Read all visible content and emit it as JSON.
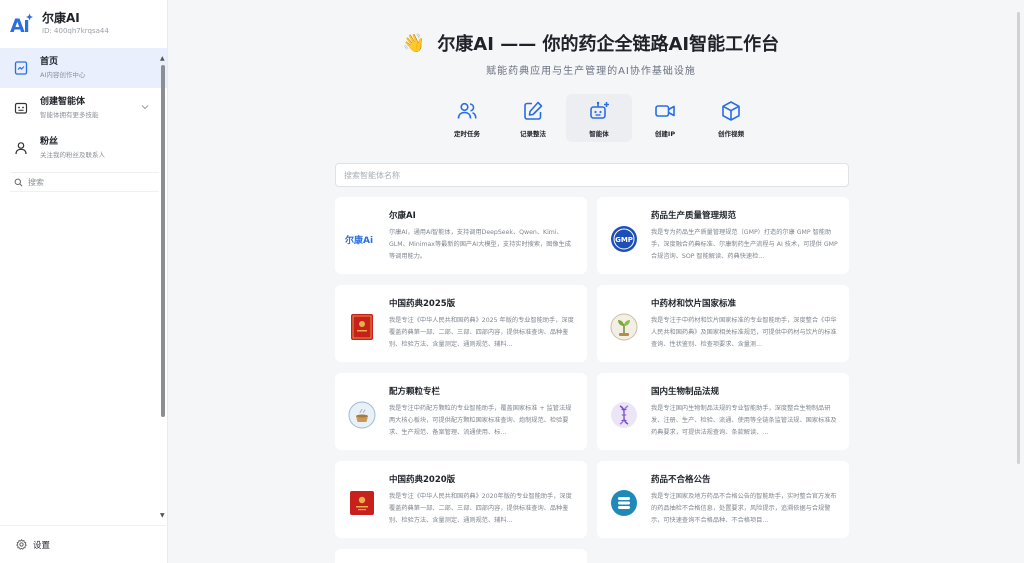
{
  "brand": {
    "name": "尔康AI",
    "id": "ID: 400qh7krqsa44"
  },
  "sidebar": {
    "items": [
      {
        "label": "首页",
        "sub": "AI内容创作中心",
        "icon": "home-doc-icon",
        "active": true
      },
      {
        "label": "创建智能体",
        "sub": "智能体拥有更多技能",
        "icon": "robot-icon",
        "active": false
      },
      {
        "label": "粉丝",
        "sub": "关注我的粉丝及联系人",
        "icon": "user-icon",
        "active": false
      }
    ],
    "search_label": "搜索",
    "settings_label": "设置"
  },
  "hero": {
    "emoji": "👋",
    "title": "尔康AI —— 你的药企全链路AI智能工作台",
    "subtitle": "赋能药典应用与生产管理的AI协作基础设施"
  },
  "tools": [
    {
      "label": "定时任务",
      "icon": "users-icon",
      "active": false
    },
    {
      "label": "记录整法",
      "icon": "edit-icon",
      "active": false
    },
    {
      "label": "智能体",
      "icon": "bot-icon",
      "active": true
    },
    {
      "label": "创建IP",
      "icon": "video-icon",
      "active": false
    },
    {
      "label": "创作视频",
      "icon": "box-icon",
      "active": false
    }
  ],
  "search": {
    "placeholder": "搜索智能体名称"
  },
  "cards": [
    {
      "title": "尔康AI",
      "desc": "尔康AI，通用AI智能体，支持调用DeepSeek、Qwen、Kimi、GLM、Minimax等最新的国产AI大模型，支持实时搜索，图像生成等调用能力。",
      "icon": "erkang-logo-icon",
      "logo_text": "尔康Ai"
    },
    {
      "title": "药品生产质量管理规范",
      "desc": "我是专为药品生产质量管理规范（GMP）打造的尔康 GMP 智能助手，深度融合药典标准、尔康制药生产流程与 AI 技术，可提供 GMP 合规咨询、SOP 智能解读、药典快速检...",
      "icon": "gmp-icon",
      "logo_text": "GMP"
    },
    {
      "title": "中国药典2025版",
      "desc": "我是专注《中华人民共和国药典》2025 年版的专业智能助手，深度覆盖药典第一部、二部、三部、四部内容，提供标准查询、品种鉴别、检验方法、含量测定、通则规范、辅料...",
      "icon": "red-book-icon",
      "logo_text": ""
    },
    {
      "title": "中药材和饮片国家标准",
      "desc": "我是专注于中药材和饮片国家标准的专业智能助手，深度整合《中华人民共和国药典》及国家相关标准规范，可提供中药材与饮片的标准查询、性状鉴别、检查项要求、含量测...",
      "icon": "herb-icon",
      "logo_text": ""
    },
    {
      "title": "配方颗粒专栏",
      "desc": "我是专注中药配方颗粒的专业智能助手，覆盖国家标准 + 监管法规两大核心板块，可提供配方颗粒国家标准查询、炮制规范、检验要求、生产规范、备案管理、流通使用、标...",
      "icon": "granule-icon",
      "logo_text": ""
    },
    {
      "title": "国内生物制品法规",
      "desc": "我是专注国内生物制品法规的专业智能助手，深度整合生物制品研发、注册、生产、检验、流通、使用等全链条监管法规、国家标准及药典要求，可提供法规查询、条款解读、...",
      "icon": "dna-icon",
      "logo_text": ""
    },
    {
      "title": "中国药典2020版",
      "desc": "我是专注《中华人民共和国药典》2020年版的专业智能助手，深度覆盖药典第一部、二部、三部、四部内容，提供标准查询、品种鉴别、检验方法、含量测定、通则规范、辅料...",
      "icon": "red-book-2020-icon",
      "logo_text": ""
    },
    {
      "title": "药品不合格公告",
      "desc": "我是专注国家及地方药品不合格公告的智能助手，实时整合官方发布的药品抽检不合格信息，处置要求，风险提示，追溯依据与合规警示，可快速查询不合格品种、不合格项目...",
      "icon": "list-icon",
      "logo_text": ""
    }
  ],
  "colors": {
    "accent": "#2b6de5",
    "active_bg": "#e9effc",
    "card_bg": "#ffffff",
    "page_bg": "#f5f6f8"
  }
}
